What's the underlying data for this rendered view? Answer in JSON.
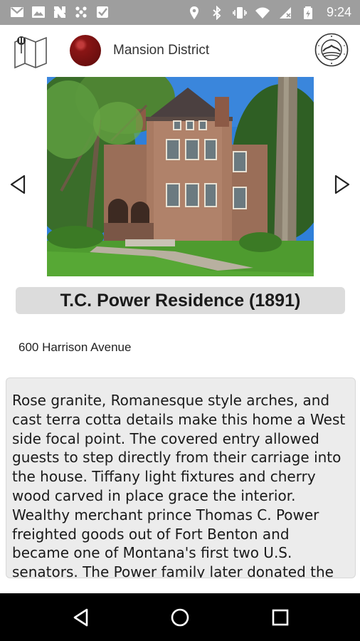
{
  "status_bar": {
    "time": "9:24",
    "left_icons": [
      "gmail-icon",
      "photos-icon",
      "news-icon",
      "dots-icon",
      "checklist-icon"
    ],
    "right_icons": [
      "location-icon",
      "bluetooth-icon",
      "vibrate-icon",
      "wifi-icon",
      "no-signal-icon",
      "battery-icon"
    ]
  },
  "header": {
    "district_name": "Mansion District",
    "district_color": "#7a1010"
  },
  "site": {
    "title": "T.C. Power Residence (1891)",
    "address": "600 Harrison Avenue",
    "description": "Rose granite, Romanesque style arches, and cast terra cotta details make this home a West side focal point. The covered entry allowed guests to step directly from their carriage into the house. Tiffany light fixtures and cherry wood carved in place grace the interior. Wealthy merchant prince Thomas C. Power freighted goods out of Fort Benton and became one of Montana's first two U.S. senators. The Power family later donated the property to the Helena"
  },
  "nav_bar": {
    "buttons": [
      "back-icon",
      "home-icon",
      "recents-icon"
    ]
  }
}
